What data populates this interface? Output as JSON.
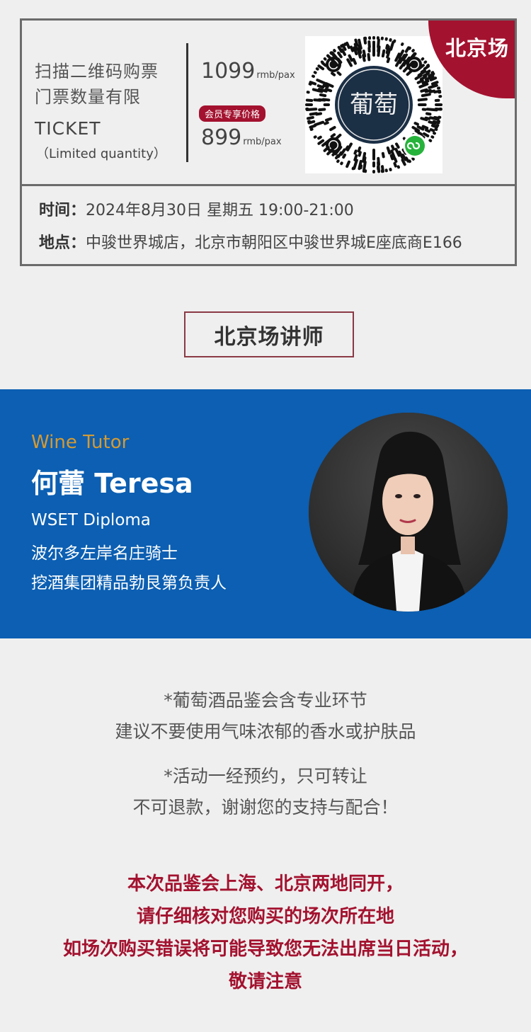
{
  "ticket": {
    "scan_line1": "扫描二维码购票",
    "scan_line2": "门票数量有限",
    "label": "TICKET",
    "sub": "（Limited quantity）",
    "price_regular": "1099",
    "price_regular_unit": "rmb/pax",
    "member_badge": "会员专享价格",
    "price_member": "899",
    "price_member_unit": "rmb/pax",
    "city_tag": "北京场",
    "qr_logo_text": "葡萄",
    "time_label": "时间：",
    "time_value": "2024年8月30日 星期五 19:00-21:00",
    "place_label": "地点：",
    "place_value": "中骏世界城店，北京市朝阳区中骏世界城E座底商E166"
  },
  "section": {
    "title": "北京场讲师"
  },
  "tutor": {
    "role": "Wine Tutor",
    "name": "何蕾 Teresa",
    "lines": [
      "WSET Diploma",
      "波尔多左岸名庄骑士",
      "挖酒集团精品勃艮第负责人"
    ]
  },
  "notes": {
    "line1": "*葡萄酒品鉴会含专业环节",
    "line2": "建议不要使用气味浓郁的香水或护肤品",
    "line3": "*活动一经预约，只可转让",
    "line4": "不可退款，谢谢您的支持与配合！"
  },
  "warning": {
    "line1": "本次品鉴会上海、北京两地同开，",
    "line2": "请仔细核对您购买的场次所在地",
    "line3": "如场次购买错误将可能导致您无法出席当日活动，",
    "line4": "敬请注意"
  },
  "colors": {
    "accent_red": "#a3122f",
    "tutor_blue": "#0c5fb2",
    "tutor_role_gold": "#d49a32"
  },
  "icons": {
    "qr": "qr-code-icon",
    "mini_program": "wechat-mini-program-icon",
    "avatar": "tutor-photo"
  }
}
